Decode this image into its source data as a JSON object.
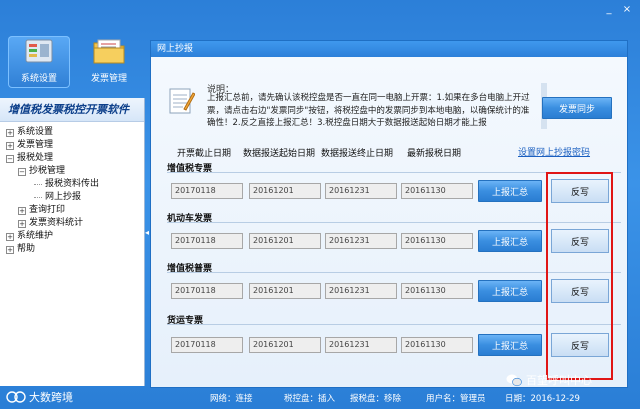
{
  "window_controls": [
    "_",
    "×"
  ],
  "toolbar": {
    "system_settings": "系统设置",
    "invoice_management": "发票管理"
  },
  "nav": {
    "title": "增值税发票税控开票软件",
    "items": [
      {
        "label": "系统设置",
        "exp": "⊞"
      },
      {
        "label": "发票管理",
        "exp": "⊞"
      },
      {
        "label": "报税处理",
        "exp": "⊟"
      },
      {
        "label": "抄税管理",
        "exp": "⊟"
      },
      {
        "label": "报税资料传出",
        "exp": ""
      },
      {
        "label": "网上抄报",
        "exp": ""
      },
      {
        "label": "查询打印",
        "exp": "⊞"
      },
      {
        "label": "发票资料统计",
        "exp": "⊞"
      },
      {
        "label": "系统维护",
        "exp": "⊞"
      },
      {
        "label": "帮助",
        "exp": "⊞"
      }
    ]
  },
  "dialog": {
    "title": "网上抄报",
    "note_title": "说明：",
    "note_text": "上报汇总前，请先确认该税控盘是否一直在同一电脑上开票：1.如果在多台电脑上开过票，请点击右边\"发票同步\"按钮，将税控盘中的发票同步到本地电脑，以确保统计的准确性！2.反之直接上报汇总！3.税控盘日期大于数据报送起始日期才能上报",
    "sync_button": "发票同步",
    "columns": [
      "开票截止日期",
      "数据报送起始日期",
      "数据报送终止日期",
      "最新报税日期"
    ],
    "settings_link": "设置网上抄报密码",
    "upload_label": "上报汇总",
    "writeback_label": "反写",
    "sections": [
      {
        "title": "增值税专票",
        "values": [
          "20170118",
          "20161201",
          "20161231",
          "20161130"
        ]
      },
      {
        "title": "机动车发票",
        "values": [
          "20170118",
          "20161201",
          "20161231",
          "20161130"
        ]
      },
      {
        "title": "增值税普票",
        "values": [
          "20170118",
          "20161201",
          "20161231",
          "20161130"
        ]
      },
      {
        "title": "货运专票",
        "values": [
          "20170118",
          "20161201",
          "20161231",
          "20161130"
        ]
      }
    ]
  },
  "statusbar": {
    "network": "网络：连接",
    "tax_disk": "税控盘：插入",
    "report_disk": "报税盘：移除",
    "user": "用户名：管理员",
    "date": "日期：2016-12-29"
  },
  "brand": "大数跨境",
  "watermark": "百望呼叫中心",
  "colors": {
    "highlight": "#e01515",
    "accent": "#2c80d9"
  }
}
